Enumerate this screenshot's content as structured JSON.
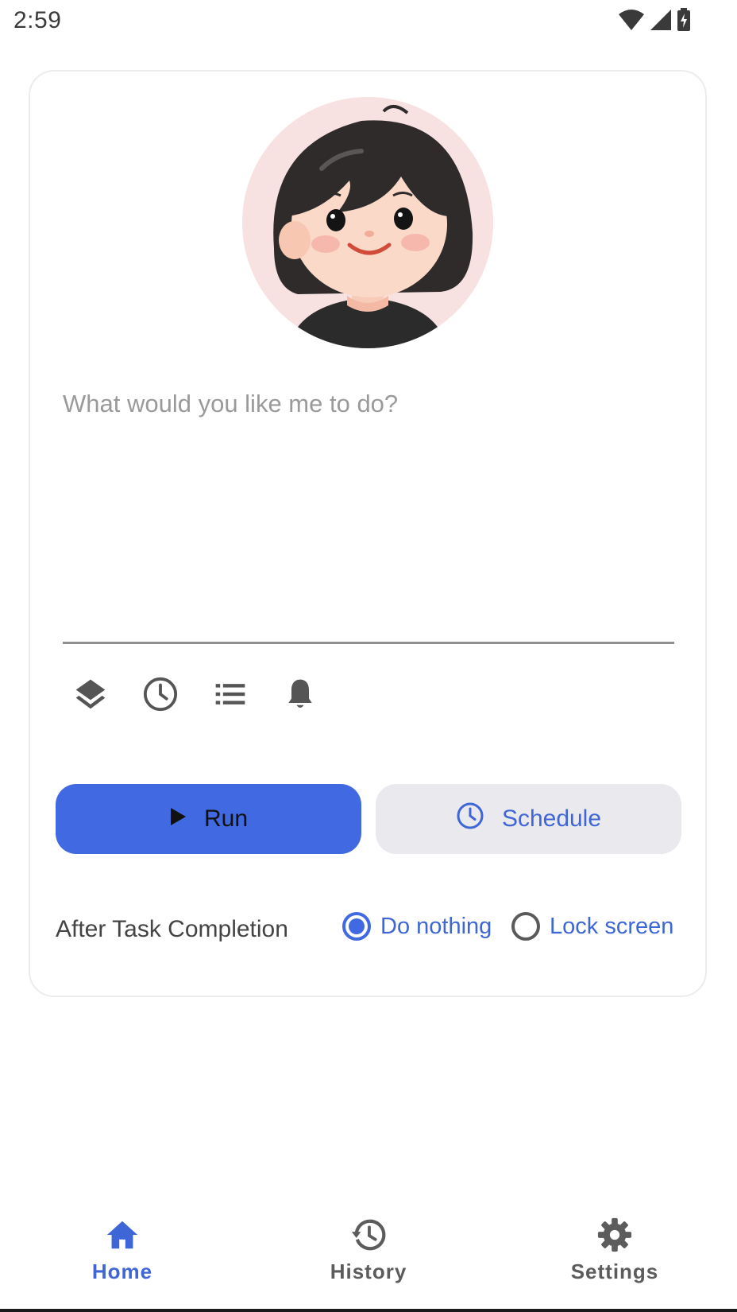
{
  "status_bar": {
    "time": "2:59"
  },
  "prompt": {
    "placeholder": "What would you like me to do?",
    "value": ""
  },
  "toolbar": {
    "icons": [
      "layers-icon",
      "clock-icon",
      "list-icon",
      "bell-icon"
    ]
  },
  "actions": {
    "run_label": "Run",
    "schedule_label": "Schedule"
  },
  "after_task": {
    "label": "After Task Completion",
    "options": [
      {
        "label": "Do nothing",
        "selected": true
      },
      {
        "label": "Lock screen",
        "selected": false
      }
    ]
  },
  "bottom_nav": {
    "items": [
      {
        "label": "Home",
        "icon": "home-icon",
        "active": true
      },
      {
        "label": "History",
        "icon": "history-icon",
        "active": false
      },
      {
        "label": "Settings",
        "icon": "gear-icon",
        "active": false
      }
    ]
  },
  "colors": {
    "accent": "#4169e1",
    "secondary_button_bg": "#e9e9ee",
    "accent_text": "#3f66d6"
  }
}
